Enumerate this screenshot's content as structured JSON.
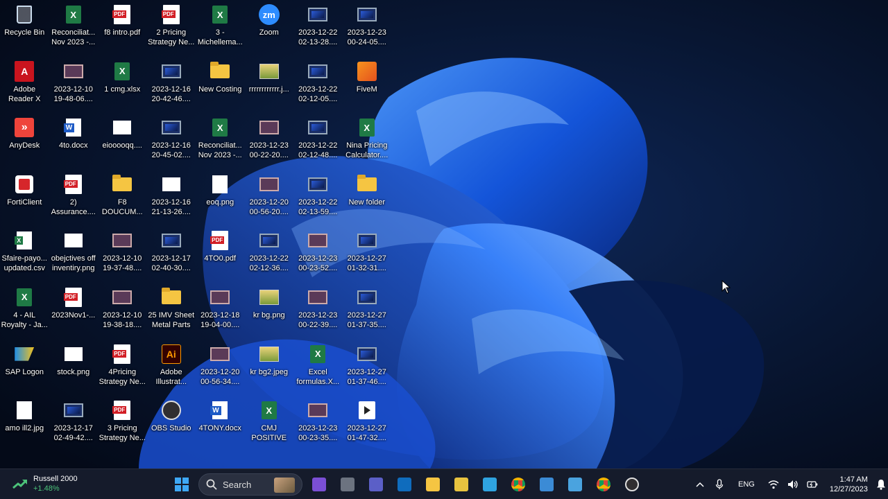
{
  "desktop": {
    "icons": [
      {
        "label": "Recycle Bin",
        "type": "recycle",
        "icon": "recycle-bin-icon"
      },
      {
        "label": "Adobe\nReader X",
        "type": "adobe",
        "icon": "adobe-reader-icon"
      },
      {
        "label": "AnyDesk",
        "type": "anydesk",
        "icon": "anydesk-icon"
      },
      {
        "label": "FortiClient",
        "type": "forti",
        "icon": "forticlient-icon"
      },
      {
        "label": "Sfaire-payo...\nupdated.csv",
        "type": "csv",
        "icon": "csv-file-icon"
      },
      {
        "label": "4 - AIL\nRoyalty - Ja...",
        "type": "xl",
        "icon": "excel-file-icon"
      },
      {
        "label": "SAP Logon",
        "type": "sap",
        "icon": "sap-logon-icon"
      },
      {
        "label": "amo ill2.jpg",
        "type": "blankdoc",
        "icon": "image-file-icon"
      },
      {
        "label": "Reconciliat...\nNov 2023 -...",
        "type": "xl",
        "icon": "excel-file-icon"
      },
      {
        "label": "2023-12-10\n19-48-06....",
        "type": "vidpink",
        "icon": "video-file-icon"
      },
      {
        "label": "4to.docx",
        "type": "word",
        "icon": "word-file-icon"
      },
      {
        "label": "2)\nAssurance....",
        "type": "pdf",
        "icon": "pdf-file-icon"
      },
      {
        "label": "obejctives off\ninventiry.png",
        "type": "blank",
        "icon": "image-file-icon"
      },
      {
        "label": "2023Nov1-...",
        "type": "pdf",
        "icon": "pdf-file-icon"
      },
      {
        "label": "stock.png",
        "type": "blank",
        "icon": "image-file-icon"
      },
      {
        "label": "2023-12-17\n02-49-42....",
        "type": "vid",
        "icon": "video-file-icon"
      },
      {
        "label": "f8 intro.pdf",
        "type": "pdf",
        "icon": "pdf-file-icon"
      },
      {
        "label": "1 cmg.xlsx",
        "type": "xl",
        "icon": "excel-file-icon"
      },
      {
        "label": "eiooooqq....",
        "type": "blank",
        "icon": "image-file-icon"
      },
      {
        "label": "F8\nDOUCUM...",
        "type": "folder",
        "icon": "folder-icon"
      },
      {
        "label": "2023-12-10\n19-37-48....",
        "type": "vidpink",
        "icon": "video-file-icon"
      },
      {
        "label": "2023-12-10\n19-38-18....",
        "type": "vidpink",
        "icon": "video-file-icon"
      },
      {
        "label": "4Pricing\nStrategy Ne...",
        "type": "pdf",
        "icon": "pdf-file-icon"
      },
      {
        "label": "3 Pricing\nStrategy Ne...",
        "type": "pdf",
        "icon": "pdf-file-icon"
      },
      {
        "label": "2 Pricing\nStrategy Ne...",
        "type": "pdf",
        "icon": "pdf-file-icon"
      },
      {
        "label": "2023-12-16\n20-42-46....",
        "type": "vid",
        "icon": "video-file-icon"
      },
      {
        "label": "2023-12-16\n20-45-02....",
        "type": "vid",
        "icon": "video-file-icon"
      },
      {
        "label": "2023-12-16\n21-13-26....",
        "type": "blank",
        "icon": "image-file-icon"
      },
      {
        "label": "2023-12-17\n02-40-30....",
        "type": "vid",
        "icon": "video-file-icon"
      },
      {
        "label": "25 IMV Sheet\nMetal Parts",
        "type": "folder",
        "icon": "folder-icon"
      },
      {
        "label": "Adobe\nIllustrat...",
        "type": "ai",
        "icon": "adobe-illustrator-icon"
      },
      {
        "label": "OBS Studio",
        "type": "obs",
        "icon": "obs-studio-icon"
      },
      {
        "label": "3 -\nMichellema...",
        "type": "xl",
        "icon": "excel-file-icon"
      },
      {
        "label": "New Costing",
        "type": "folder",
        "icon": "folder-icon"
      },
      {
        "label": "Reconciliat...\nNov 2023 -...",
        "type": "xl",
        "icon": "excel-file-icon"
      },
      {
        "label": "eoq.png",
        "type": "blankdoc",
        "icon": "image-file-icon"
      },
      {
        "label": "4TO0.pdf",
        "type": "pdf",
        "icon": "pdf-file-icon"
      },
      {
        "label": "2023-12-18\n19-04-00....",
        "type": "vidpink",
        "icon": "video-file-icon"
      },
      {
        "label": "2023-12-20\n00-56-34....",
        "type": "vidpink",
        "icon": "video-file-icon"
      },
      {
        "label": "4TONY.docx",
        "type": "word",
        "icon": "word-file-icon"
      },
      {
        "label": "Zoom",
        "type": "zoom",
        "icon": "zoom-icon"
      },
      {
        "label": "rrrrrrrrrrrr.j...",
        "type": "img",
        "icon": "image-file-icon"
      },
      {
        "label": "2023-12-23\n00-22-20....",
        "type": "vidpink",
        "icon": "video-file-icon"
      },
      {
        "label": "2023-12-20\n00-56-20....",
        "type": "vidpink",
        "icon": "video-file-icon"
      },
      {
        "label": "2023-12-22\n02-12-36....",
        "type": "vid",
        "icon": "video-file-icon"
      },
      {
        "label": "kr bg.png",
        "type": "img",
        "icon": "image-file-icon"
      },
      {
        "label": "kr bg2.jpeg",
        "type": "img",
        "icon": "image-file-icon"
      },
      {
        "label": "CMJ\nPOSITIVE C...",
        "type": "xl",
        "icon": "excel-file-icon"
      },
      {
        "label": "2023-12-22\n02-13-28....",
        "type": "vid",
        "icon": "video-file-icon"
      },
      {
        "label": "2023-12-22\n02-12-05....",
        "type": "vid",
        "icon": "video-file-icon"
      },
      {
        "label": "2023-12-22\n02-12-48....",
        "type": "vid",
        "icon": "video-file-icon"
      },
      {
        "label": "2023-12-22\n02-13-59....",
        "type": "vid",
        "icon": "video-file-icon"
      },
      {
        "label": "2023-12-23\n00-23-52....",
        "type": "vidpink",
        "icon": "video-file-icon"
      },
      {
        "label": "2023-12-23\n00-22-39....",
        "type": "vidpink",
        "icon": "video-file-icon"
      },
      {
        "label": "Excel\nformulas.X...",
        "type": "xl",
        "icon": "excel-file-icon"
      },
      {
        "label": "2023-12-23\n00-23-35....",
        "type": "vidpink",
        "icon": "video-file-icon"
      },
      {
        "label": "2023-12-23\n00-24-05....",
        "type": "vid",
        "icon": "video-file-icon"
      },
      {
        "label": "FiveM",
        "type": "fivem",
        "icon": "fivem-icon"
      },
      {
        "label": "Nina Pricing\nCalculator....",
        "type": "xl",
        "icon": "excel-file-icon"
      },
      {
        "label": "New folder",
        "type": "folder",
        "icon": "folder-icon"
      },
      {
        "label": "2023-12-27\n01-32-31....",
        "type": "vid",
        "icon": "video-file-icon"
      },
      {
        "label": "2023-12-27\n01-37-35....",
        "type": "vid",
        "icon": "video-file-icon"
      },
      {
        "label": "2023-12-27\n01-37-46....",
        "type": "vid",
        "icon": "video-file-icon"
      },
      {
        "label": "2023-12-27\n01-47-32....",
        "type": "play",
        "icon": "video-player-file-icon"
      }
    ]
  },
  "taskbar": {
    "widget": {
      "name": "Russell 2000",
      "change": "+1.48%",
      "icon": "stock-up-arrow-icon"
    },
    "search_label": "Search",
    "pinned": [
      {
        "name": "copilot-app",
        "color": "#7b4fd6"
      },
      {
        "name": "task-view",
        "color": "#6c7380"
      },
      {
        "name": "teams",
        "color": "#5b5fc7"
      },
      {
        "name": "outlook",
        "color": "#0f6cbd"
      },
      {
        "name": "file-explorer",
        "color": "#f5c542"
      },
      {
        "name": "notes-app",
        "color": "#e8c33f"
      },
      {
        "name": "remote-desktop",
        "color": "#2fa3e0"
      },
      {
        "name": "chrome",
        "color": "#db4437"
      },
      {
        "name": "file-app",
        "color": "#3b8bd6"
      },
      {
        "name": "photos-app",
        "color": "#4aa3df"
      },
      {
        "name": "chrome-profile",
        "color": "#34a853"
      },
      {
        "name": "obs-tray",
        "color": "#ffffff"
      }
    ],
    "tray": {
      "language": "ENG",
      "time": "1:47 AM",
      "date": "12/27/2023"
    }
  },
  "colors": {
    "accent": "#3ea8f5",
    "taskbar_bg": "#161c2c",
    "stock_up": "#4cc37a"
  }
}
